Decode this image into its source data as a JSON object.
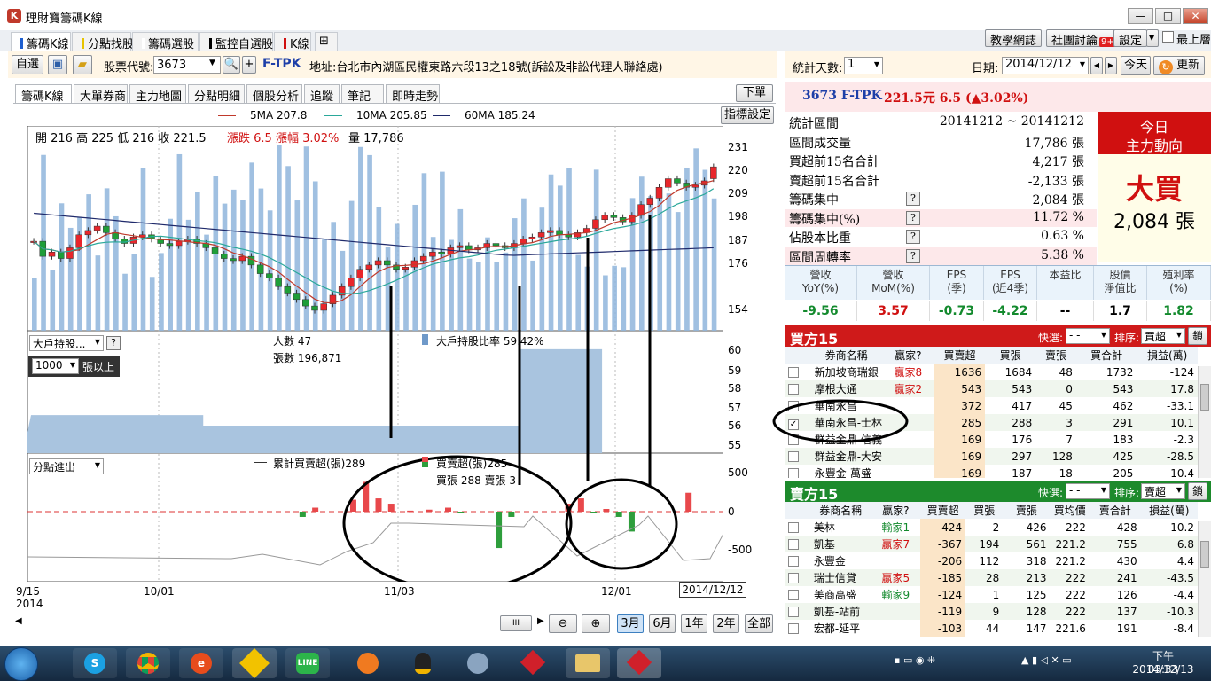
{
  "window": {
    "title": "理財寶籌碼K線",
    "min": "—",
    "max": "□",
    "close": "✕"
  },
  "top_tabs": [
    {
      "label": "籌碼K線",
      "color": "#1e5fd0"
    },
    {
      "label": "分點找股",
      "color": "#e8c400"
    },
    {
      "label": "籌碼選股",
      "color": "#ffffff"
    },
    {
      "label": "監控自選股",
      "color": "#000000"
    },
    {
      "label": "K線",
      "color": "#d01010"
    }
  ],
  "top_right": {
    "teach": "教學網誌",
    "forum": "社團討論",
    "forum_badge": "9+",
    "settings": "設定",
    "always_top": "最上層"
  },
  "toolbar": {
    "self_select": "自選",
    "stock_label": "股票代號:",
    "stock_code": "3673",
    "stock_name": "F-TPK",
    "address": "地址:台北市內湖區民權東路六段13之18號(訴訟及非訟代理人聯絡處)"
  },
  "sub_tabs": [
    "籌碼K線",
    "大單券商",
    "主力地圖",
    "分點明細",
    "個股分析",
    "追蹤",
    "筆記",
    "即時走勢"
  ],
  "order_button": "下單",
  "indicator_button": "指標設定",
  "ma_legend": {
    "ma5": "5MA 207.8",
    "ma10": "10MA 205.85",
    "ma60": "60MA 185.24",
    "ma5_color": "#c0392b",
    "ma10_color": "#2aa89a",
    "ma60_color": "#1f2a6b"
  },
  "ohlc": {
    "open": "開 216",
    "high": "高 225",
    "low": "低 216",
    "close": "收 221.5",
    "change": "漲跌 6.5",
    "pct": "漲幅 3.02%",
    "vol": "量 17,786"
  },
  "price_ticks": [
    "231",
    "220",
    "209",
    "198",
    "187",
    "176",
    "154"
  ],
  "holder_panel": {
    "select": "大戶持股...",
    "threshold": "1000",
    "unit": "張以上",
    "people_label": "人數 47",
    "lots_label": "張數 196,871",
    "ratio_label": "大戶持股比率 59.42%",
    "ticks": [
      "60",
      "59",
      "58",
      "57",
      "56",
      "55"
    ]
  },
  "branch_panel": {
    "select": "分點進出",
    "cum_label": "累計買賣超(張)289",
    "net_label": "買賣超(張)285",
    "buysell_label": "買張 288 賣張 3",
    "ticks": [
      "500",
      "0",
      "-500"
    ]
  },
  "dates": {
    "d1": "9/15",
    "y1": "2014",
    "d2": "10/01",
    "d3": "11/03",
    "d4": "12/01",
    "cursor": "2014/12/12"
  },
  "bottom_buttons": [
    "3月",
    "6月",
    "1年",
    "2年",
    "全部"
  ],
  "scroll_grip": "III",
  "right": {
    "stat_days_label": "統計天數:",
    "stat_days": "1",
    "date_label": "日期:",
    "date": "2014/12/12",
    "today": "今天",
    "refresh": "更新",
    "quote": {
      "code": "3673 F-TPK",
      "price": "221.5元 6.5 (▲3.02%)"
    },
    "stats": [
      {
        "k": "統計區間",
        "v": "20141212 ~ 20141212",
        "q": false
      },
      {
        "k": "區間成交量",
        "v": "17,786 張",
        "q": false
      },
      {
        "k": "買超前15名合計",
        "v": "4,217 張",
        "q": false
      },
      {
        "k": "賣超前15名合計",
        "v": "-2,133 張",
        "q": false
      },
      {
        "k": "籌碼集中",
        "v": "2,084 張",
        "q": true
      },
      {
        "k": "籌碼集中(%)",
        "v": "11.72 %",
        "q": true
      },
      {
        "k": "佔股本比重",
        "v": "0.63 %",
        "q": true
      },
      {
        "k": "區間周轉率",
        "v": "5.38 %",
        "q": true
      }
    ],
    "main_force": {
      "title1": "今日",
      "title2": "主力動向",
      "action": "大買",
      "amount": "2,084 張"
    },
    "fund_headers": [
      "營收\nYoY(%)",
      "營收\nMoM(%)",
      "EPS\n(季)",
      "EPS\n(近4季)",
      "本益比",
      "股價\n淨值比",
      "殖利率\n(%)"
    ],
    "fund_values": [
      "-9.56",
      "3.57",
      "-0.73",
      "-4.22",
      "--",
      "1.7",
      "1.82"
    ],
    "buy15": {
      "title": "買方15",
      "quick": "快選:",
      "quick_val": "- -",
      "sort": "排序:",
      "sort_val": "買超",
      "lock": "鎖",
      "headers": [
        "券商名稱",
        "贏家?",
        "買賣超",
        "買張",
        "賣張",
        "買合計",
        "損益(萬)"
      ],
      "rows": [
        [
          "新加坡商瑞銀",
          "贏家8",
          "1636",
          "1684",
          "48",
          "1732",
          "-124"
        ],
        [
          "摩根大通",
          "贏家2",
          "543",
          "543",
          "0",
          "543",
          "17.8"
        ],
        [
          "華南永昌",
          "",
          "372",
          "417",
          "45",
          "462",
          "-33.1"
        ],
        [
          "華南永昌-士林",
          "",
          "285",
          "288",
          "3",
          "291",
          "10.1"
        ],
        [
          "群益金鼎-信義",
          "",
          "169",
          "176",
          "7",
          "183",
          "-2.3"
        ],
        [
          "群益金鼎-大安",
          "",
          "169",
          "297",
          "128",
          "425",
          "-28.5"
        ],
        [
          "永豐金-萬盛",
          "",
          "169",
          "187",
          "18",
          "205",
          "-10.4"
        ]
      ]
    },
    "sell15": {
      "title": "賣方15",
      "quick": "快選:",
      "quick_val": "- -",
      "sort": "排序:",
      "sort_val": "賣超",
      "lock": "鎖",
      "headers": [
        "券商名稱",
        "贏家?",
        "買賣超",
        "買張",
        "賣張",
        "買均價",
        "賣合計",
        "損益(萬)"
      ],
      "rows": [
        [
          "美林",
          "輸家1",
          "-424",
          "2",
          "426",
          "222",
          "428",
          "10.2"
        ],
        [
          "凱基",
          "贏家7",
          "-367",
          "194",
          "561",
          "221.2",
          "755",
          "6.8"
        ],
        [
          "永豐金",
          "",
          "-206",
          "112",
          "318",
          "221.2",
          "430",
          "4.4"
        ],
        [
          "瑞士信貸",
          "贏家5",
          "-185",
          "28",
          "213",
          "222",
          "241",
          "-43.5"
        ],
        [
          "美商高盛",
          "輸家9",
          "-124",
          "1",
          "125",
          "222",
          "126",
          "-4.4"
        ],
        [
          "凱基-站前",
          "",
          "-119",
          "9",
          "128",
          "222",
          "137",
          "-10.3"
        ],
        [
          "宏都-延平",
          "",
          "-103",
          "44",
          "147",
          "221.6",
          "191",
          "-8.4"
        ]
      ]
    }
  },
  "chart_data": {
    "type": "candlestick",
    "x": [
      "2014/9/15",
      "2014/10/01",
      "2014/11/03",
      "2014/12/01",
      "2014/12/12"
    ],
    "ylim": [
      148,
      238
    ],
    "closes": [
      187,
      180,
      182,
      179,
      184,
      190,
      192,
      194,
      191,
      188,
      186,
      189,
      190,
      188,
      186,
      185,
      187,
      188,
      186,
      184,
      181,
      179,
      178,
      180,
      176,
      172,
      170,
      166,
      163,
      160,
      157,
      155,
      158,
      162,
      166,
      170,
      174,
      176,
      178,
      176,
      174,
      175,
      178,
      180,
      182,
      181,
      184,
      185,
      183,
      184,
      186,
      185,
      184,
      186,
      188,
      189,
      191,
      192,
      190,
      189,
      191,
      193,
      197,
      199,
      198,
      196,
      199,
      204,
      207,
      212,
      216,
      214,
      212,
      213,
      215,
      221.5
    ],
    "last_ohlc": [
      216,
      225,
      216,
      221.5
    ],
    "holder_ratio_range": [
      54.5,
      60
    ],
    "holder_ratio_last": 59.42,
    "branch_net_last": 285,
    "branch_buy_last": 288,
    "branch_sell_last": 3,
    "branch_ylim": [
      -750,
      750
    ]
  },
  "taskbar": {
    "time": "下午 03:33",
    "date": "2014/12/13"
  }
}
